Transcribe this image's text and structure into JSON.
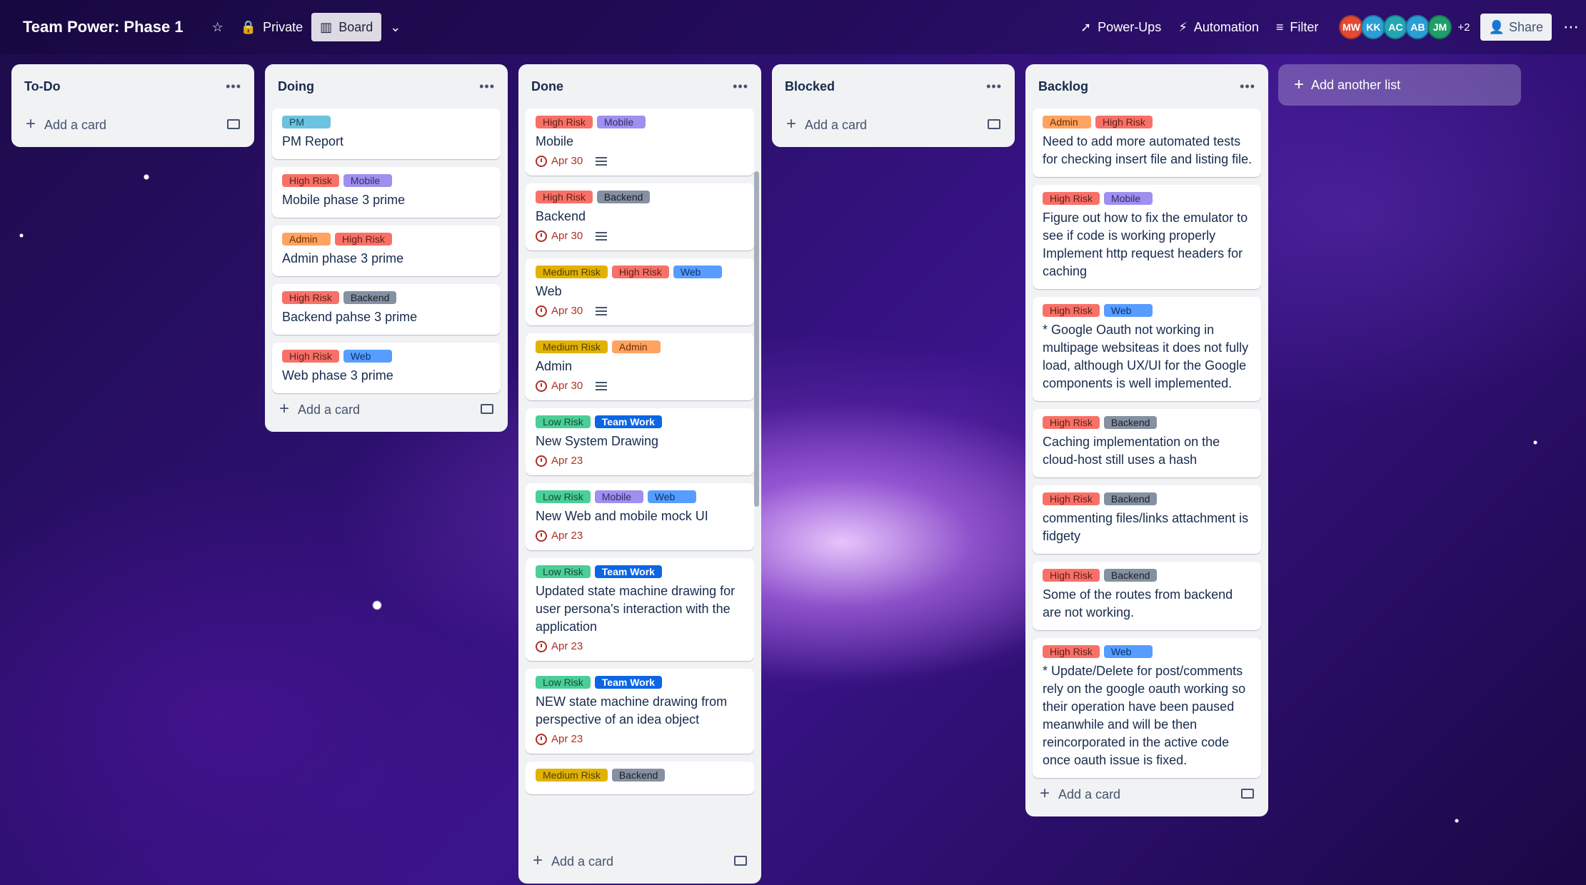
{
  "board": {
    "title": "Team Power: Phase 1",
    "visibility": "Private",
    "view": "Board"
  },
  "header_right": {
    "powerups": "Power-Ups",
    "automation": "Automation",
    "filter": "Filter",
    "members": [
      {
        "initials": "MW",
        "color": "#e34935"
      },
      {
        "initials": "KK",
        "color": "#2a9fd6"
      },
      {
        "initials": "AC",
        "color": "#22a6b3"
      },
      {
        "initials": "AB",
        "color": "#2a9fd6"
      },
      {
        "initials": "JM",
        "color": "#1f9e6a"
      }
    ],
    "more_members": "+2",
    "share": "Share"
  },
  "lists": [
    {
      "title": "To-Do",
      "add_card": "Add a card",
      "cards": []
    },
    {
      "title": "Doing",
      "add_card": "Add a card",
      "cards": [
        {
          "labels": [
            {
              "text": "PM",
              "cls": "c-pm"
            }
          ],
          "title": "PM Report"
        },
        {
          "labels": [
            {
              "text": "High Risk",
              "cls": "c-high"
            },
            {
              "text": "Mobile",
              "cls": "c-mobile"
            }
          ],
          "title": "Mobile phase 3 prime"
        },
        {
          "labels": [
            {
              "text": "Admin",
              "cls": "c-admin"
            },
            {
              "text": "High Risk",
              "cls": "c-high"
            }
          ],
          "title": "Admin phase 3 prime"
        },
        {
          "labels": [
            {
              "text": "High Risk",
              "cls": "c-high"
            },
            {
              "text": "Backend",
              "cls": "c-backend"
            }
          ],
          "title": "Backend pahse 3 prime"
        },
        {
          "labels": [
            {
              "text": "High Risk",
              "cls": "c-high"
            },
            {
              "text": "Web",
              "cls": "c-web"
            }
          ],
          "title": "Web phase 3 prime"
        }
      ]
    },
    {
      "title": "Done",
      "add_card": "Add a card",
      "cards": [
        {
          "labels": [
            {
              "text": "High Risk",
              "cls": "c-high"
            },
            {
              "text": "Mobile",
              "cls": "c-mobile"
            }
          ],
          "title": "Mobile",
          "due": "Apr 30",
          "desc": true
        },
        {
          "labels": [
            {
              "text": "High Risk",
              "cls": "c-high"
            },
            {
              "text": "Backend",
              "cls": "c-backend"
            }
          ],
          "title": "Backend",
          "due": "Apr 30",
          "desc": true
        },
        {
          "labels": [
            {
              "text": "Medium Risk",
              "cls": "c-medium"
            },
            {
              "text": "High Risk",
              "cls": "c-high"
            },
            {
              "text": "Web",
              "cls": "c-web"
            }
          ],
          "title": "Web",
          "due": "Apr 30",
          "desc": true
        },
        {
          "labels": [
            {
              "text": "Medium Risk",
              "cls": "c-medium"
            },
            {
              "text": "Admin",
              "cls": "c-admin"
            }
          ],
          "title": "Admin",
          "due": "Apr 30",
          "desc": true
        },
        {
          "labels": [
            {
              "text": "Low Risk",
              "cls": "c-low"
            },
            {
              "text": "Team Work",
              "cls": "c-team"
            }
          ],
          "title": "New System Drawing",
          "due": "Apr 23"
        },
        {
          "labels": [
            {
              "text": "Low Risk",
              "cls": "c-low"
            },
            {
              "text": "Mobile",
              "cls": "c-mobile"
            },
            {
              "text": "Web",
              "cls": "c-web"
            }
          ],
          "title": "New Web and mobile mock UI",
          "due": "Apr 23"
        },
        {
          "labels": [
            {
              "text": "Low Risk",
              "cls": "c-low"
            },
            {
              "text": "Team Work",
              "cls": "c-team"
            }
          ],
          "title": "Updated state machine drawing for user persona's interaction with the application",
          "due": "Apr 23"
        },
        {
          "labels": [
            {
              "text": "Low Risk",
              "cls": "c-low"
            },
            {
              "text": "Team Work",
              "cls": "c-team"
            }
          ],
          "title": "NEW state machine drawing from perspective of an idea object",
          "due": "Apr 23"
        },
        {
          "labels": [
            {
              "text": "Medium Risk",
              "cls": "c-medium"
            },
            {
              "text": "Backend",
              "cls": "c-backend"
            }
          ],
          "title": ""
        }
      ]
    },
    {
      "title": "Blocked",
      "add_card": "Add a card",
      "cards": []
    },
    {
      "title": "Backlog",
      "add_card": "Add a card",
      "cards": [
        {
          "labels": [
            {
              "text": "Admin",
              "cls": "c-admin"
            },
            {
              "text": "High Risk",
              "cls": "c-high"
            }
          ],
          "title": "Need to add more automated tests for checking insert file and listing file."
        },
        {
          "labels": [
            {
              "text": "High Risk",
              "cls": "c-high"
            },
            {
              "text": "Mobile",
              "cls": "c-mobile"
            }
          ],
          "title": "Figure out how to fix the emulator to see if code is working properly Implement http request headers for caching"
        },
        {
          "labels": [
            {
              "text": "High Risk",
              "cls": "c-high"
            },
            {
              "text": "Web",
              "cls": "c-web"
            }
          ],
          "title": "* Google Oauth not working in multipage websiteas it does not fully load, although UX/UI for the Google components is well implemented."
        },
        {
          "labels": [
            {
              "text": "High Risk",
              "cls": "c-high"
            },
            {
              "text": "Backend",
              "cls": "c-backend"
            }
          ],
          "title": "Caching implementation on the cloud-host still uses a hash"
        },
        {
          "labels": [
            {
              "text": "High Risk",
              "cls": "c-high"
            },
            {
              "text": "Backend",
              "cls": "c-backend"
            }
          ],
          "title": "commenting files/links attachment is fidgety"
        },
        {
          "labels": [
            {
              "text": "High Risk",
              "cls": "c-high"
            },
            {
              "text": "Backend",
              "cls": "c-backend"
            }
          ],
          "title": "Some of the routes from backend are not working."
        },
        {
          "labels": [
            {
              "text": "High Risk",
              "cls": "c-high"
            },
            {
              "text": "Web",
              "cls": "c-web"
            }
          ],
          "title": "* Update/Delete for post/comments rely on the google oauth working so their operation have been paused meanwhile and will be then reincorporated in the active code once oauth issue is fixed."
        }
      ]
    }
  ],
  "add_list": "Add another list"
}
